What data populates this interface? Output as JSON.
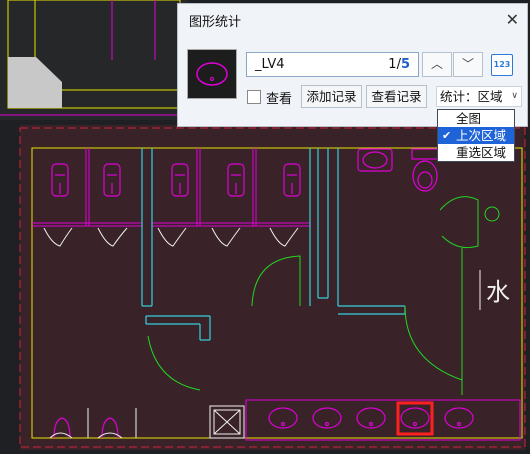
{
  "dialog": {
    "title": "图形统计",
    "block_name": "_LV4",
    "counter_current": "1/",
    "counter_total": "5",
    "prev_glyph": "︿",
    "next_glyph": "﹀",
    "id_button_label": "123",
    "view_label": "查看",
    "view_checked": false,
    "add_record_label": "添加记录",
    "view_record_label": "查看记录",
    "stat_prefix": "统计：",
    "stat_value": "区域",
    "close_glyph": "✕"
  },
  "dropdown": {
    "options": [
      {
        "label": "全图",
        "selected": false
      },
      {
        "label": "上次区域",
        "selected": true
      },
      {
        "label": "重选区域",
        "selected": false
      }
    ]
  },
  "drawing": {
    "room_label": "水",
    "colors": {
      "background": "#1f2024",
      "room_fill": "#3a2328",
      "yellow": "#e8e400",
      "cyan": "#35d0dc",
      "magenta": "#e000d8",
      "green": "#22d622",
      "white": "#f0f0f0",
      "red": "#ff2020",
      "dash_red": "#d02040"
    }
  }
}
